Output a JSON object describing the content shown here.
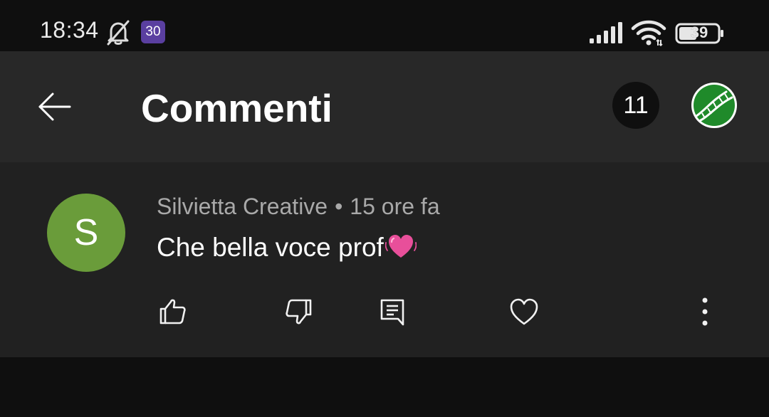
{
  "status_bar": {
    "time": "18:34",
    "notification_badge": "30",
    "battery_level": "39",
    "icons": [
      "bell-off-icon",
      "signal-icon",
      "wifi-icon",
      "battery-icon"
    ]
  },
  "header": {
    "title": "Commenti",
    "comment_count": "11",
    "icons": [
      "back-arrow-icon",
      "channel-avatar"
    ]
  },
  "comment": {
    "author": "Silvietta Creative",
    "separator": "•",
    "time_ago": "15 ore fa",
    "text": "Che bella voce prof",
    "avatar_letter": "S",
    "avatar_color": "#6a9c3a",
    "emoji": "beating-heart",
    "actions": [
      "like-icon",
      "dislike-icon",
      "reply-icon",
      "heart-icon",
      "more-icon"
    ]
  },
  "colors": {
    "background": "#0f0f0f",
    "header": "#282828",
    "card": "#212121",
    "meta_text": "#a9a9a9",
    "emoji_pink": "#e84f9a"
  }
}
